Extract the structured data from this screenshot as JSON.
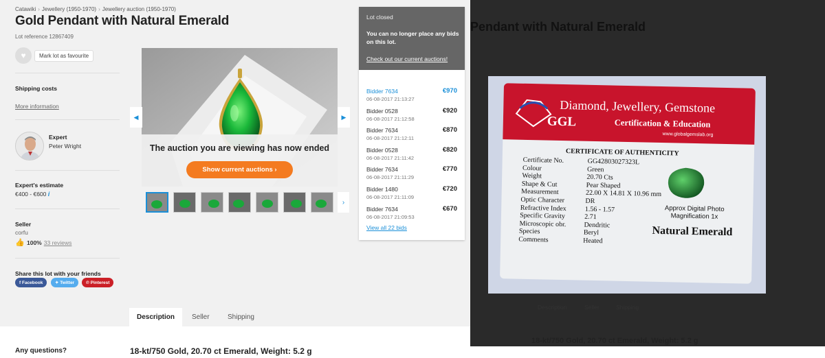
{
  "breadcrumb": [
    "Catawiki",
    "Jewellery (1950-1970)",
    "Jewellery auction (1950-1970)"
  ],
  "breadcrumb_sep": "›",
  "lot": {
    "title": "Gold Pendant with Natural Emerald",
    "reference": "Lot reference 12867409",
    "favourite_label": "Mark lot as favourite"
  },
  "shipping": {
    "heading": "Shipping costs",
    "link": "More information"
  },
  "expert": {
    "heading": "Expert",
    "name": "Peter Wright"
  },
  "estimate": {
    "heading": "Expert's estimate",
    "value": "€400 - €600"
  },
  "seller": {
    "heading": "Seller",
    "name": "corfu",
    "rating": "100%",
    "reviews": "33 reviews"
  },
  "share": {
    "heading": "Share this lot with your friends",
    "facebook": "Facebook",
    "twitter": "Twitter",
    "pinterest": "Pinterest"
  },
  "gallery": {
    "ended_text": "The auction you are viewing has now ended",
    "show_button": "Show current auctions",
    "thumbnail_count": 7
  },
  "tabs": [
    "Description",
    "Seller",
    "Shipping"
  ],
  "questions": "Any questions?",
  "description": "18-kt/750 Gold, 20.70 ct Emerald, Weight: 5.2 g",
  "status_panel": {
    "status": "Lot closed",
    "message": "You can no longer place any bids on this lot.",
    "link": "Check out our current auctions!"
  },
  "bids": [
    {
      "bidder": "Bidder 7634",
      "time": "06-08-2017 21:13:27",
      "amount": "€970"
    },
    {
      "bidder": "Bidder 0528",
      "time": "06-08-2017 21:12:58",
      "amount": "€920"
    },
    {
      "bidder": "Bidder 7634",
      "time": "06-08-2017 21:12:11",
      "amount": "€870"
    },
    {
      "bidder": "Bidder 0528",
      "time": "06-08-2017 21:11:42",
      "amount": "€820"
    },
    {
      "bidder": "Bidder 7634",
      "time": "06-08-2017 21:11:29",
      "amount": "€770"
    },
    {
      "bidder": "Bidder 1480",
      "time": "06-08-2017 21:11:09",
      "amount": "€720"
    },
    {
      "bidder": "Bidder 7634",
      "time": "06-08-2017 21:09:53",
      "amount": "€670"
    }
  ],
  "view_all_bids": "View all 22 bids",
  "certificate": {
    "company": "Diamond, Jewellery, Gemstone",
    "brand": "GGL",
    "subtitle": "Certification & Education",
    "website": "www.globalgemslab.org",
    "heading": "CERTIFICATE OF AUTHENTICITY",
    "fields": [
      {
        "label": "Certificate No.",
        "value": "GG42803027323L"
      },
      {
        "label": "Colour",
        "value": "Green"
      },
      {
        "label": "Weight",
        "value": "20.70 Cts"
      },
      {
        "label": "Shape & Cut",
        "value": "Pear Shaped"
      },
      {
        "label": "Measurement",
        "value": "22.00 X 14.81 X 10.96 mm"
      },
      {
        "label": "Optic Character",
        "value": "DR"
      },
      {
        "label": "Refractive Index",
        "value": "1.56 - 1.57"
      },
      {
        "label": "Specific Gravity",
        "value": "2.71"
      },
      {
        "label": "Microscopic obr.",
        "value": "Dendritic"
      },
      {
        "label": "Species",
        "value": "Beryl"
      },
      {
        "label": "Comments",
        "value": "Heated"
      }
    ],
    "photo_note": "Approx Digital Photo Magnification 1x",
    "stone": "Natural Emerald"
  },
  "colors": {
    "accent_blue": "#1a8fd8",
    "orange": "#f47b20",
    "panel_grey": "#666666",
    "cert_red": "#c8142c"
  }
}
